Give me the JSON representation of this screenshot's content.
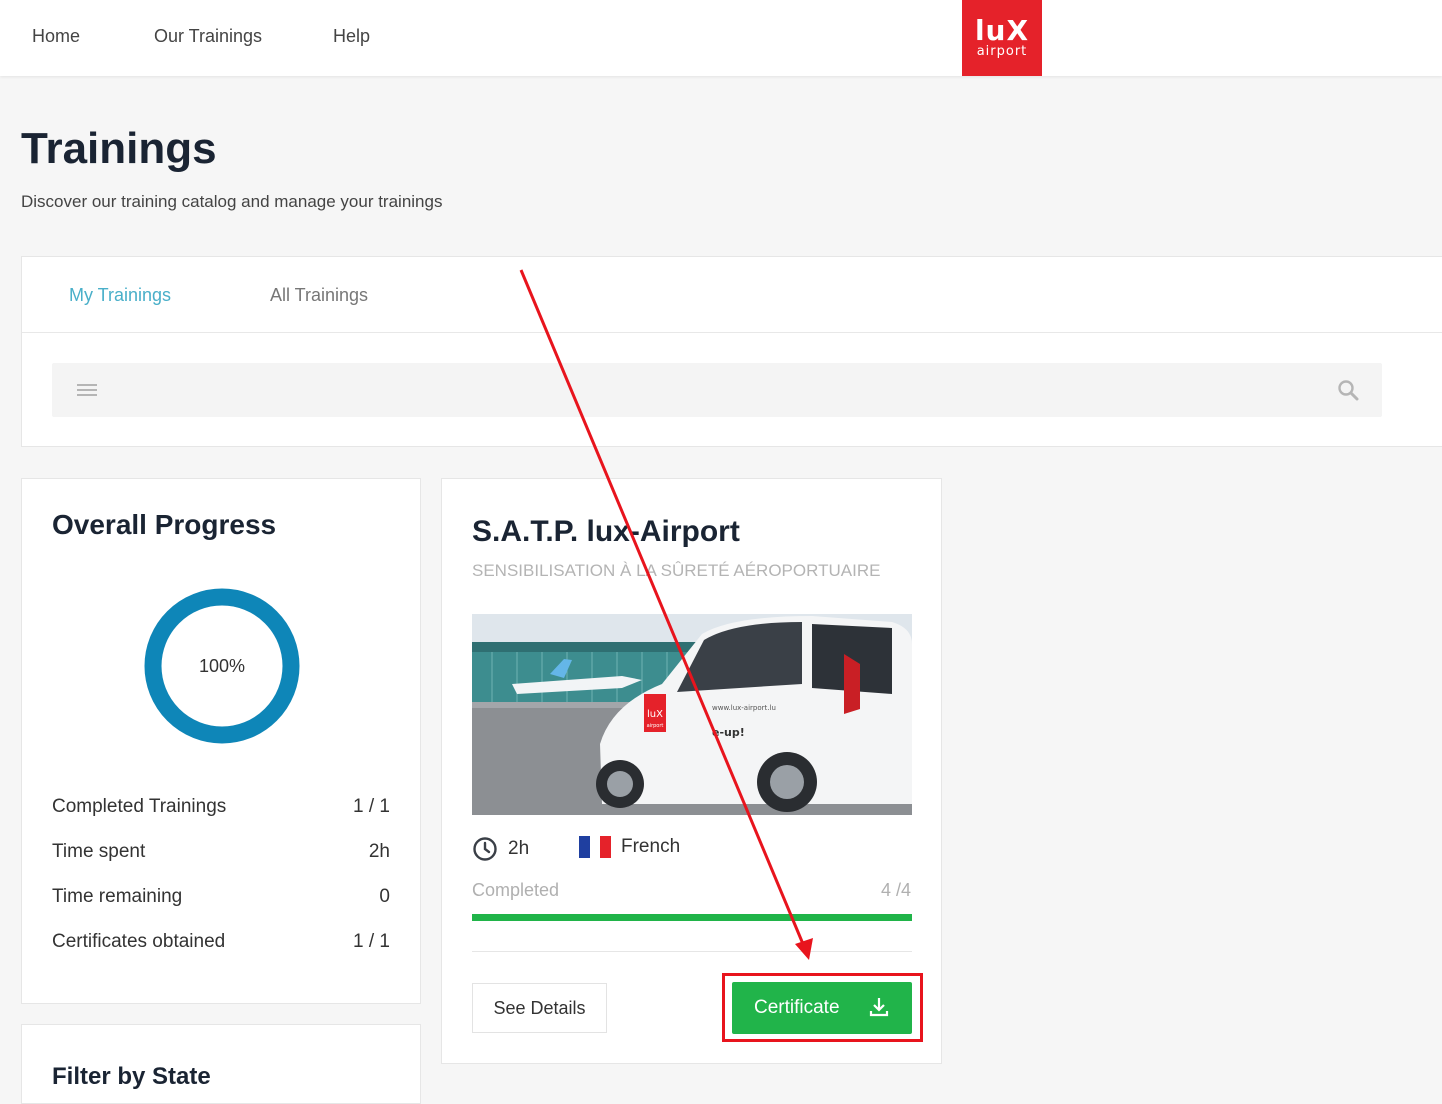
{
  "nav": {
    "items": [
      {
        "label": "Home"
      },
      {
        "label": "Our Trainings"
      },
      {
        "label": "Help"
      }
    ],
    "logo": {
      "line1": "luX",
      "line2": "airport",
      "color": "#e5222a"
    }
  },
  "page": {
    "title": "Trainings",
    "subtitle": "Discover our training catalog and manage your trainings"
  },
  "tabs": [
    {
      "label": "My Trainings",
      "active": true
    },
    {
      "label": "All Trainings",
      "active": false
    }
  ],
  "search": {
    "value": "",
    "placeholder": ""
  },
  "overall_progress": {
    "title": "Overall Progress",
    "percent_label": "100%",
    "percent": 100,
    "ring_color": "#0e86b8",
    "stats": [
      {
        "label": "Completed Trainings",
        "value": "1 / 1"
      },
      {
        "label": "Time spent",
        "value": "2h"
      },
      {
        "label": "Time remaining",
        "value": "0"
      },
      {
        "label": "Certificates obtained",
        "value": "1 / 1"
      }
    ]
  },
  "filter": {
    "title": "Filter by State"
  },
  "training": {
    "title": "S.A.T.P. lux-Airport",
    "subtitle": "SENSIBILISATION À LA SÛRETÉ AÉROPORTUAIRE",
    "duration": "2h",
    "language": "French",
    "status": "Completed",
    "progress_count": "4 /4",
    "progress_fraction": 1.0,
    "progress_color": "#20b449",
    "details_label": "See Details",
    "certificate_label": "Certificate",
    "certificate_color": "#21b44a",
    "image_lettering": {
      "badge": "luX",
      "badge_sub": "airport",
      "site": "www.lux-airport.lu",
      "brand": "e-up!"
    }
  },
  "annotation": {
    "color": "#e8141d"
  }
}
